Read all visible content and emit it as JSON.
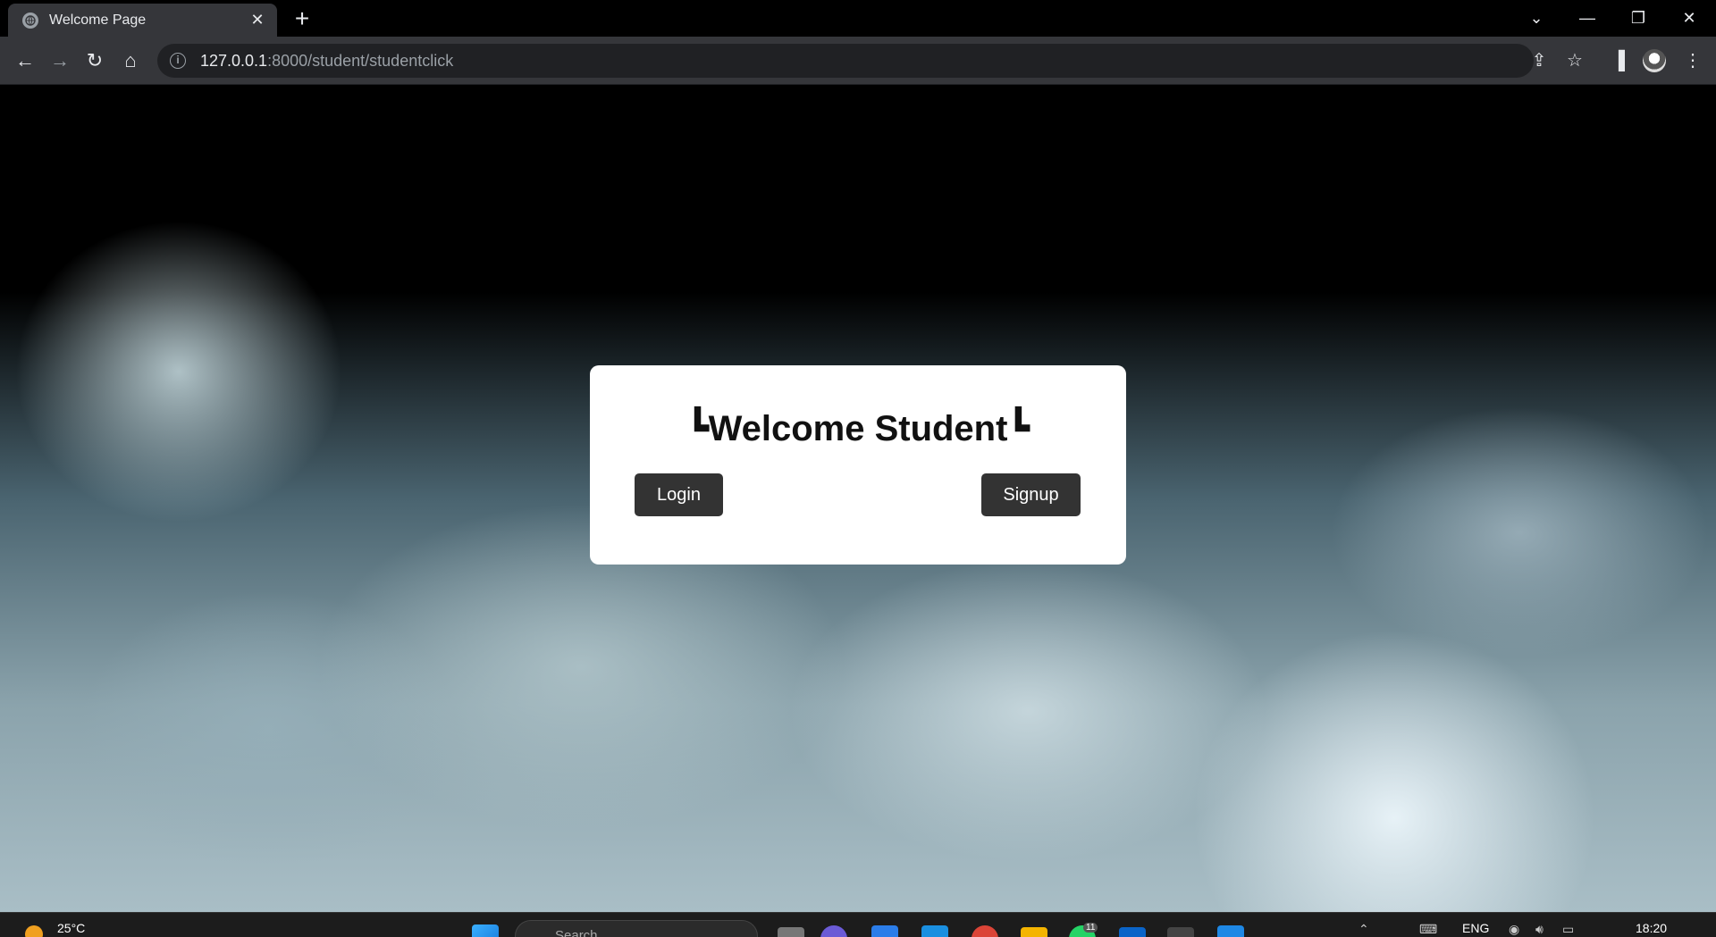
{
  "browser": {
    "tab_title": "Welcome Page",
    "url_host": "127.0.0.1",
    "url_path": ":8000/student/studentclick"
  },
  "page": {
    "heading": "┗Welcome Student┗",
    "login_label": "Login",
    "signup_label": "Signup"
  },
  "taskbar": {
    "weather": "25°C",
    "search_placeholder": "Search",
    "language": "ENG",
    "time": "18:20",
    "whatsapp_badge": "11"
  },
  "icons": [
    "globe-icon",
    "close-icon",
    "plus-icon",
    "chevron-down-icon",
    "minimize-icon",
    "restore-icon",
    "back-icon",
    "forward-icon",
    "reload-icon",
    "home-icon",
    "info-icon",
    "share-icon",
    "star-icon",
    "sidepanel-icon",
    "profile-avatar"
  ]
}
